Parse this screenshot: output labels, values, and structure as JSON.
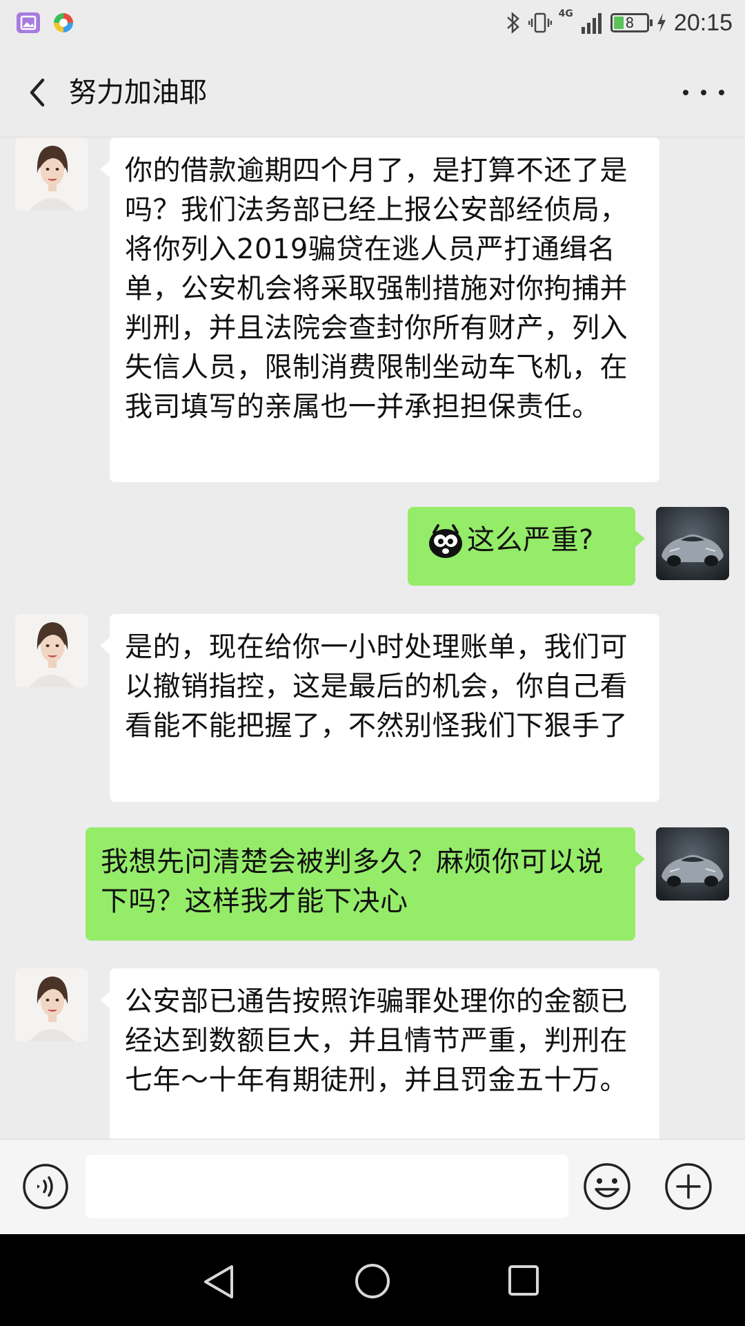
{
  "status_bar": {
    "network": "4G",
    "battery": "8",
    "time": "20:15"
  },
  "header": {
    "title": "努力加油耶"
  },
  "messages": [
    {
      "side": "left",
      "avatar": "woman-avatar",
      "text": "你的借款逾期四个月了，是打算不还了是吗？我们法务部已经上报公安部经侦局，将你列入2019骗贷在逃人员严打通缉名单，公安机会将采取强制措施对你拘捕并判刑，并且法院会查封你所有财产，列入失信人员，限制消费限制坐动车飞机，在我司填写的亲属也一并承担担保责任。"
    },
    {
      "side": "right",
      "avatar": "car-avatar",
      "emoji": "shocked-emoji",
      "text": "这么严重?"
    },
    {
      "side": "left",
      "avatar": "woman-avatar",
      "text": "是的，现在给你一小时处理账单，我们可以撤销指控，这是最后的机会，你自己看看能不能把握了，不然别怪我们下狠手了"
    },
    {
      "side": "right",
      "avatar": "car-avatar",
      "text": "我想先问清楚会被判多久？麻烦你可以说下吗？这样我才能下决心"
    },
    {
      "side": "left",
      "avatar": "woman-avatar",
      "text": "公安部已通告按照诈骗罪处理你的金额已经达到数额巨大，并且情节严重，判刑在七年～十年有期徒刑，并且罚金五十万。"
    }
  ],
  "input_bar": {
    "placeholder": ""
  },
  "colors": {
    "sent_bubble": "#95ec69",
    "received_bubble": "#ffffff",
    "background": "#ececec"
  }
}
